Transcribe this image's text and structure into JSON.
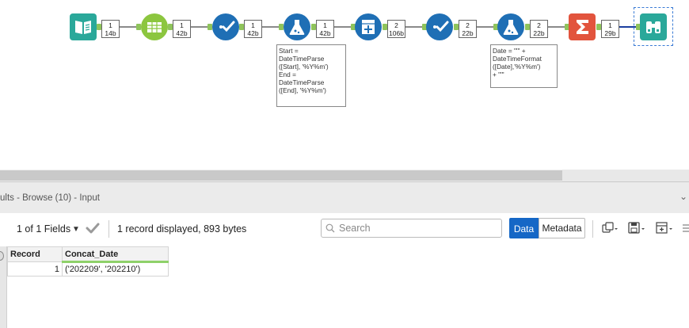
{
  "workflow": {
    "badges": [
      {
        "line1": "1",
        "line2": "14b"
      },
      {
        "line1": "1",
        "line2": "42b"
      },
      {
        "line1": "1",
        "line2": "42b"
      },
      {
        "line1": "1",
        "line2": "42b"
      },
      {
        "line1": "2",
        "line2": "106b"
      },
      {
        "line1": "2",
        "line2": "22b"
      },
      {
        "line1": "2",
        "line2": "22b"
      },
      {
        "line1": "1",
        "line2": "29b"
      }
    ],
    "annotations": {
      "formula1": "Start =\nDateTimeParse\n([Start], '%Y%m')\nEnd =\nDateTimeParse\n([End], '%Y%m')",
      "formula2": "Date = \"'\" +\nDateTimeFormat\n([Date],'%Y%m')\n+ \"'\""
    },
    "colors": {
      "input": "#2aa89a",
      "text_to_columns": "#8cc63f",
      "select": "#1f6fb5",
      "formula": "#1f6fb5",
      "generate": "#1f6fb5",
      "summarize": "#e2543d",
      "browse": "#2aa89a"
    }
  },
  "results": {
    "title": "ults - Browse (10) - Input",
    "fields_label": "1 of 1 Fields",
    "record_info": "1 record displayed, 893 bytes",
    "search_placeholder": "Search",
    "data_button": "Data",
    "metadata_button": "Metadata",
    "columns": [
      "Record",
      "Concat_Date"
    ],
    "rows": [
      {
        "record": "1",
        "concat_date": "('202209', '202210')"
      }
    ]
  }
}
